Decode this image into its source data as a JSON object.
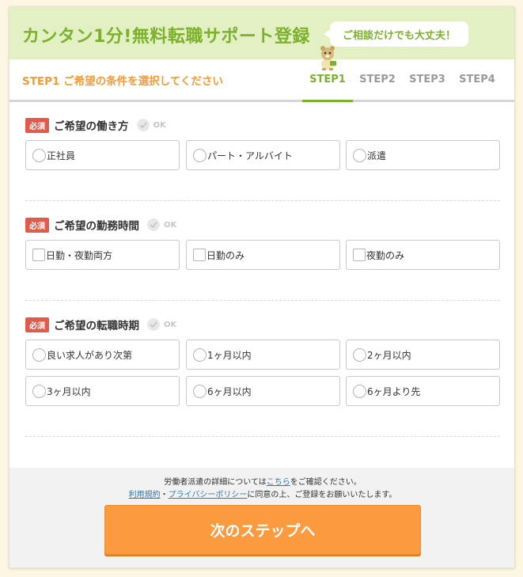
{
  "header": {
    "title": "カンタン1分!無料転職サポート登録",
    "bubble": "ご相談だけでも大丈夫！"
  },
  "steps": {
    "label": "STEP1 ご希望の条件を選択してください",
    "tabs": [
      "STEP1",
      "STEP2",
      "STEP3",
      "STEP4"
    ],
    "active": 0
  },
  "required_badge": "必須",
  "ok_text": "OK",
  "questions": [
    {
      "title": "ご希望の働き方",
      "input_type": "radio",
      "options": [
        "正社員",
        "パート・アルバイト",
        "派遣"
      ]
    },
    {
      "title": "ご希望の勤務時間",
      "input_type": "checkbox",
      "options": [
        "日勤・夜勤両方",
        "日勤のみ",
        "夜勤のみ"
      ]
    },
    {
      "title": "ご希望の転職時期",
      "input_type": "radio",
      "options": [
        "良い求人があり次第",
        "1ヶ月以内",
        "2ヶ月以内",
        "3ヶ月以内",
        "6ヶ月以内",
        "6ヶ月より先"
      ]
    }
  ],
  "footer": {
    "note_prefix": "労働者派遣の詳細については",
    "note_link": "こちら",
    "note_suffix": "をご確認ください。",
    "terms_link": "利用規約",
    "separator": "・",
    "privacy_link": "プライバシーポリシー",
    "consent_suffix": "に同意の上、ご登録をお願いいたします。",
    "next_button": "次のステップへ"
  },
  "colors": {
    "brand_green": "#7cb12b",
    "accent_orange": "#f79a34",
    "required_red": "#e15a4a",
    "button_orange": "#fb9a3e"
  }
}
